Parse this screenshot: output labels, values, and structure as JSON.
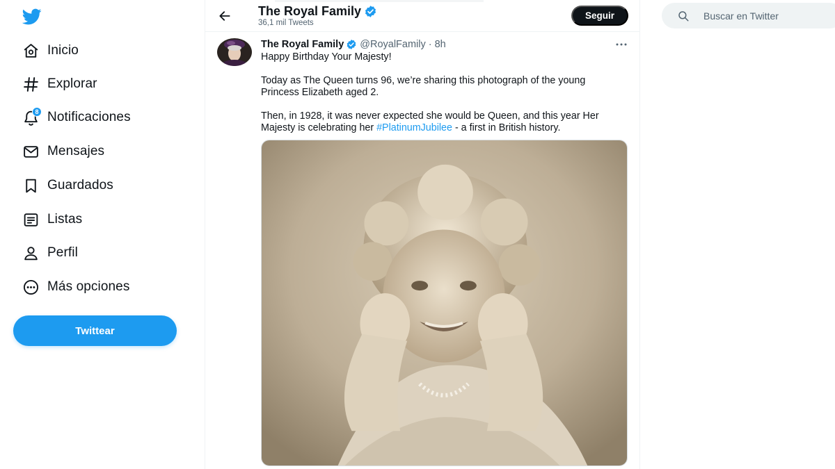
{
  "brand": {
    "logo_icon": "twitter-bird-icon",
    "color": "#1d9bf0"
  },
  "sidebar": {
    "items": [
      {
        "label": "Inicio",
        "icon": "home-icon"
      },
      {
        "label": "Explorar",
        "icon": "hashtag-icon"
      },
      {
        "label": "Notificaciones",
        "icon": "bell-icon",
        "badge": "8"
      },
      {
        "label": "Mensajes",
        "icon": "envelope-icon"
      },
      {
        "label": "Guardados",
        "icon": "bookmark-icon"
      },
      {
        "label": "Listas",
        "icon": "list-icon"
      },
      {
        "label": "Perfil",
        "icon": "person-icon"
      },
      {
        "label": "Más opciones",
        "icon": "more-circle-icon"
      }
    ],
    "tweet_button": "Twittear"
  },
  "header": {
    "title": "The Royal Family",
    "tweet_count": "36,1 mil Tweets",
    "follow_button": "Seguir"
  },
  "tweet": {
    "author_name": "The Royal Family",
    "handle": "@RoyalFamily",
    "separator": "·",
    "time": "8h",
    "text": {
      "line1": "Happy Birthday Your Majesty!",
      "p2_l1": "Today as The Queen turns 96, we’re sharing this photograph of the young",
      "p2_l2": "Princess Elizabeth aged 2.",
      "p3_l1": "Then, in 1928, it was never expected she would be Queen, and this year Her",
      "p3_l2_pre": "Majesty is celebrating her ",
      "hashtag": "#PlatinumJubilee",
      "p3_l2_post": " - a first in British history."
    }
  },
  "search": {
    "placeholder": "Buscar en Twitter"
  },
  "colors": {
    "accent": "#1d9bf0",
    "text": "#0f1419",
    "muted": "#536471",
    "border": "#eff3f4"
  }
}
